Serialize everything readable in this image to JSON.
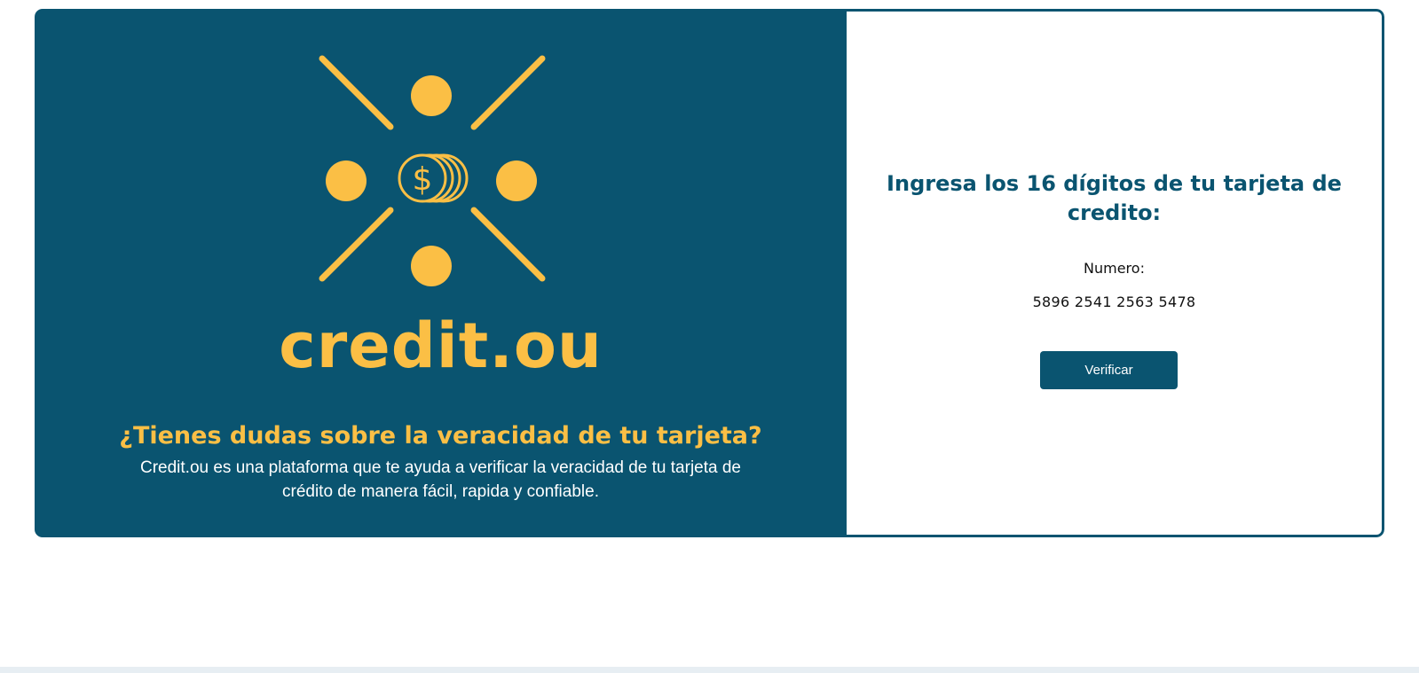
{
  "brand": {
    "name": "credit.ou",
    "logo_icon": "coin-stack-sunburst-icon"
  },
  "hero": {
    "tagline": "¿Tienes dudas sobre la veracidad de tu tarjeta?",
    "description": "Credit.ou es una plataforma que te ayuda a verificar la veracidad de tu tarjeta de crédito de manera fácil, rapida y confiable."
  },
  "form": {
    "title": "Ingresa los 16 dígitos de tu tarjeta de credito:",
    "number_label": "Numero:",
    "number_value": "5896 2541 2563 5478",
    "verify_label": "Verificar"
  },
  "colors": {
    "primary": "#0a5470",
    "accent": "#fbbf45",
    "background": "#ffffff"
  }
}
